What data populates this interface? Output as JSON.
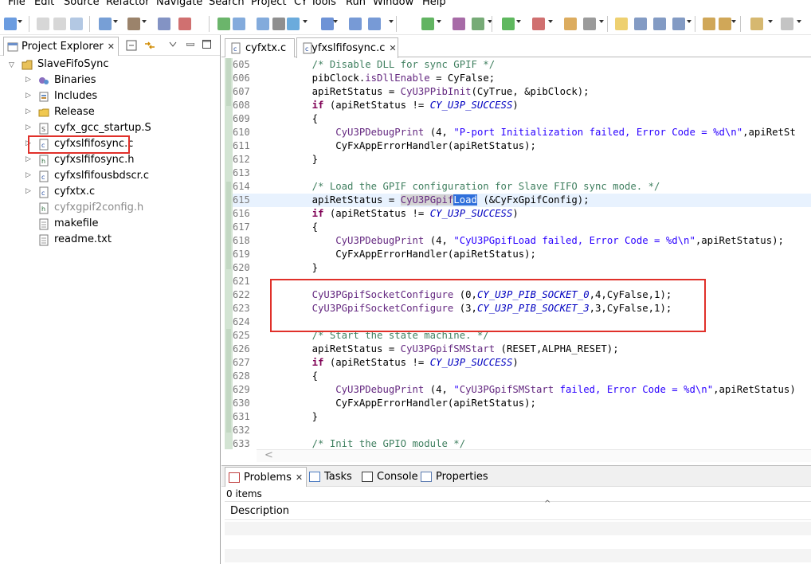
{
  "menu": [
    "File",
    "Edit",
    "Source",
    "Refactor",
    "Navigate",
    "Search",
    "Project",
    "CY Tools",
    "Run",
    "Window",
    "Help"
  ],
  "project_explorer": {
    "title": "Project Explorer",
    "root": "SlaveFifoSync",
    "items": [
      {
        "label": "Binaries",
        "icon": "binaries-icon",
        "expandable": true
      },
      {
        "label": "Includes",
        "icon": "includes-icon",
        "expandable": true
      },
      {
        "label": "Release",
        "icon": "folder-icon",
        "expandable": true
      },
      {
        "label": "cyfx_gcc_startup.S",
        "icon": "asm-file-icon",
        "expandable": true
      },
      {
        "label": "cyfxslfifosync.c",
        "icon": "c-file-icon",
        "expandable": true,
        "selected": true
      },
      {
        "label": "cyfxslfifosync.h",
        "icon": "h-file-icon",
        "expandable": true
      },
      {
        "label": "cyfxslfifousbdscr.c",
        "icon": "c-file-icon",
        "expandable": true
      },
      {
        "label": "cyfxtx.c",
        "icon": "c-file-icon",
        "expandable": true
      },
      {
        "label": "cyfxgpif2config.h",
        "icon": "h-file-icon",
        "expandable": false,
        "dimmed": true
      },
      {
        "label": "makefile",
        "icon": "text-file-icon",
        "expandable": false
      },
      {
        "label": "readme.txt",
        "icon": "text-file-icon",
        "expandable": false
      }
    ]
  },
  "editor": {
    "tabs": [
      {
        "label": "cyfxtx.c",
        "active": false
      },
      {
        "label": "cyfxslfifosync.c",
        "active": true
      }
    ],
    "lines": [
      {
        "n": "605",
        "t": "    /* Disable DLL for sync GPIF */"
      },
      {
        "n": "606",
        "t": "    pibClock.isDllEnable = CyFalse;"
      },
      {
        "n": "607",
        "t": "    apiRetStatus = CyU3PPibInit(CyTrue, &pibClock);"
      },
      {
        "n": "608",
        "t": "    if (apiRetStatus != CY_U3P_SUCCESS)"
      },
      {
        "n": "609",
        "t": "    {"
      },
      {
        "n": "610",
        "t": "        CyU3PDebugPrint (4, \"P-port Initialization failed, Error Code = %d\\n\",apiRetSt"
      },
      {
        "n": "611",
        "t": "        CyFxAppErrorHandler(apiRetStatus);"
      },
      {
        "n": "612",
        "t": "    }"
      },
      {
        "n": "613",
        "t": ""
      },
      {
        "n": "614",
        "t": "    /* Load the GPIF configuration for Slave FIFO sync mode. */"
      },
      {
        "n": "615",
        "t": "    apiRetStatus = CyU3PGpifLoad (&CyFxGpifConfig);"
      },
      {
        "n": "616",
        "t": "    if (apiRetStatus != CY_U3P_SUCCESS)"
      },
      {
        "n": "617",
        "t": "    {"
      },
      {
        "n": "618",
        "t": "        CyU3PDebugPrint (4, \"CyU3PGpifLoad failed, Error Code = %d\\n\",apiRetStatus);"
      },
      {
        "n": "619",
        "t": "        CyFxAppErrorHandler(apiRetStatus);"
      },
      {
        "n": "620",
        "t": "    }"
      },
      {
        "n": "621",
        "t": ""
      },
      {
        "n": "622",
        "t": "    CyU3PGpifSocketConfigure (0,CY_U3P_PIB_SOCKET_0,4,CyFalse,1);"
      },
      {
        "n": "623",
        "t": "    CyU3PGpifSocketConfigure (3,CY_U3P_PIB_SOCKET_3,3,CyFalse,1);"
      },
      {
        "n": "624",
        "t": ""
      },
      {
        "n": "625",
        "t": "    /* Start the state machine. */"
      },
      {
        "n": "626",
        "t": "    apiRetStatus = CyU3PGpifSMStart (RESET,ALPHA_RESET);"
      },
      {
        "n": "627",
        "t": "    if (apiRetStatus != CY_U3P_SUCCESS)"
      },
      {
        "n": "628",
        "t": "    {"
      },
      {
        "n": "629",
        "t": "        CyU3PDebugPrint (4, \"CyU3PGpifSMStart failed, Error Code = %d\\n\",apiRetStatus)"
      },
      {
        "n": "630",
        "t": "        CyFxAppErrorHandler(apiRetStatus);"
      },
      {
        "n": "631",
        "t": "    }"
      },
      {
        "n": "632",
        "t": ""
      },
      {
        "n": "633",
        "t": "    /* Init the GPIO module */"
      }
    ]
  },
  "bottom": {
    "tabs": [
      "Problems",
      "Tasks",
      "Console",
      "Properties"
    ],
    "items_count": "0 items",
    "column": "Description"
  },
  "colors": {
    "annotation_box": "#e0302a",
    "selection": "#2f6fdb",
    "comment": "#3f7f5f",
    "keyword": "#7f0055",
    "function": "#642880",
    "string": "#2a00ff",
    "macro": "#0000c0"
  }
}
